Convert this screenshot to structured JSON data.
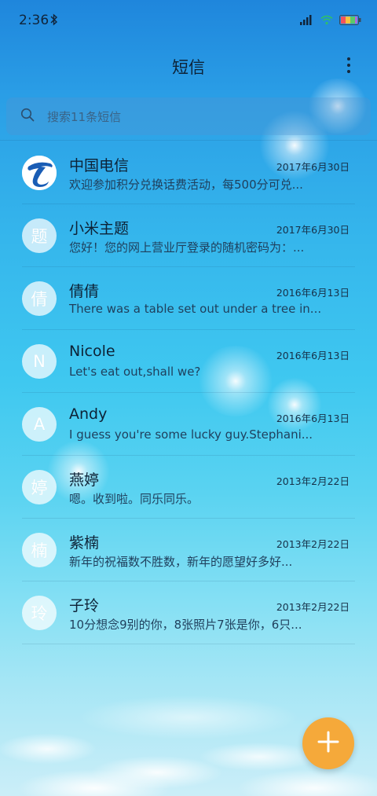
{
  "status_bar": {
    "time": "2:36"
  },
  "header": {
    "title": "短信"
  },
  "search": {
    "placeholder": "搜索11条短信"
  },
  "conversations": [
    {
      "avatar": "",
      "avatar_type": "china-telecom-logo",
      "name": "中国电信",
      "date": "2017年6月30日",
      "preview": "欢迎参加积分兑换话费活动，每500分可兑..."
    },
    {
      "avatar": "题",
      "avatar_type": "initial",
      "name": "小米主题",
      "date": "2017年6月30日",
      "preview": "您好！您的网上营业厅登录的随机密码为：..."
    },
    {
      "avatar": "倩",
      "avatar_type": "initial",
      "name": "倩倩",
      "date": "2016年6月13日",
      "preview": "There was a table set out under a tree in..."
    },
    {
      "avatar": "N",
      "avatar_type": "initial",
      "name": "Nicole",
      "date": "2016年6月13日",
      "preview": "Let's eat out,shall we?"
    },
    {
      "avatar": "A",
      "avatar_type": "initial",
      "name": "Andy",
      "date": "2016年6月13日",
      "preview": "I guess you're some lucky guy.Stephani..."
    },
    {
      "avatar": "婷",
      "avatar_type": "initial",
      "name": "燕婷",
      "date": "2013年2月22日",
      "preview": "嗯。收到啦。同乐同乐。"
    },
    {
      "avatar": "楠",
      "avatar_type": "initial",
      "name": "紫楠",
      "date": "2013年2月22日",
      "preview": "新年的祝福数不胜数，新年的愿望好多好..."
    },
    {
      "avatar": "玲",
      "avatar_type": "initial",
      "name": "子玲",
      "date": "2013年2月22日",
      "preview": "10分想念9别的你，8张照片7张是你，6只..."
    }
  ],
  "fab": {
    "icon": "plus-icon",
    "color": "#f5a93a"
  },
  "colors": {
    "accent": "#f5a93a",
    "telecom_blue": "#1a5db5"
  }
}
